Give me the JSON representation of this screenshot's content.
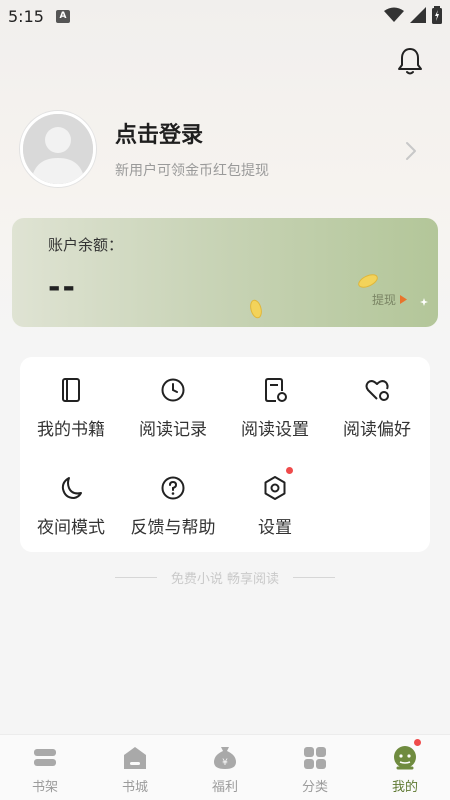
{
  "status_bar": {
    "time": "5:15",
    "notification_badge": "A"
  },
  "header": {
    "notification_icon": "bell-icon"
  },
  "profile": {
    "login_title": "点击登录",
    "login_subtitle": "新用户可领金币红包提现"
  },
  "balance": {
    "label": "账户余额：",
    "value": "--",
    "withdraw_label": "提现",
    "accent": "#e8742c"
  },
  "menu": {
    "items": [
      {
        "label": "我的书籍",
        "icon": "book-icon"
      },
      {
        "label": "阅读记录",
        "icon": "clock-icon"
      },
      {
        "label": "阅读设置",
        "icon": "reading-settings-icon"
      },
      {
        "label": "阅读偏好",
        "icon": "heart-settings-icon"
      },
      {
        "label": "夜间模式",
        "icon": "moon-icon"
      },
      {
        "label": "反馈与帮助",
        "icon": "help-icon"
      },
      {
        "label": "设置",
        "icon": "hexagon-gear-icon"
      }
    ]
  },
  "slogan": "免费小说 畅享阅读",
  "bottom_nav": {
    "items": [
      {
        "label": "书架",
        "icon": "bookshelf-icon"
      },
      {
        "label": "书城",
        "icon": "bookstore-icon"
      },
      {
        "label": "福利",
        "icon": "money-bag-icon"
      },
      {
        "label": "分类",
        "icon": "category-icon"
      },
      {
        "label": "我的",
        "icon": "profile-face-icon"
      }
    ],
    "active_color": "#5f7a33",
    "inactive_color": "#9b9b9b"
  }
}
